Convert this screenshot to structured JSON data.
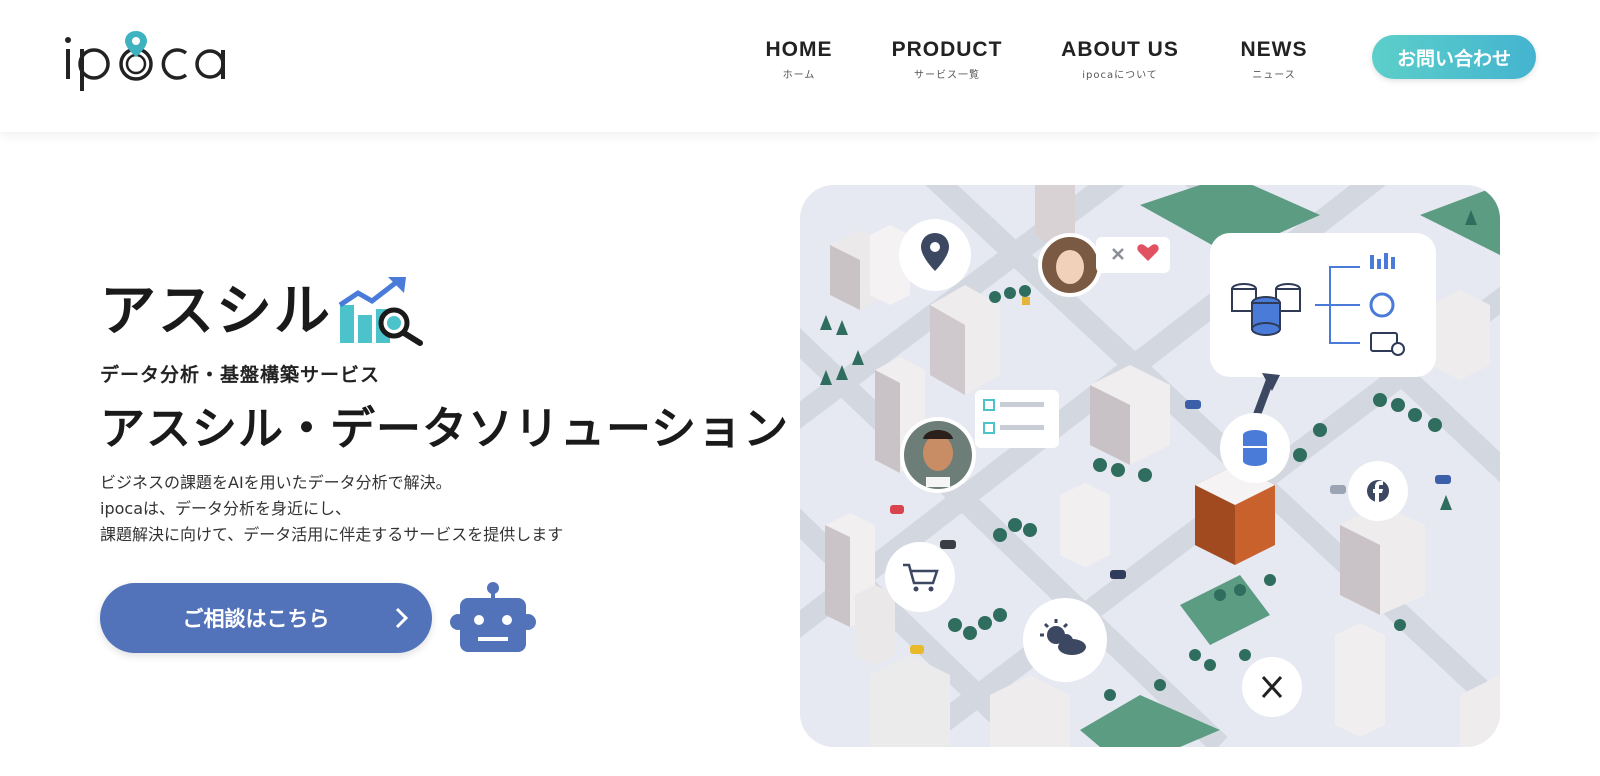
{
  "header": {
    "logo_text": "ipoca",
    "nav": [
      {
        "label": "HOME",
        "sub": "ホーム"
      },
      {
        "label": "PRODUCT",
        "sub": "サービス一覧"
      },
      {
        "label": "ABOUT US",
        "sub": "ipocaについて"
      },
      {
        "label": "NEWS",
        "sub": "ニュース"
      }
    ],
    "contact_label": "お問い合わせ"
  },
  "hero": {
    "brand_name": "アスシル",
    "subtitle": "データ分析・基盤構築サービス",
    "title": "アスシル・データソリューション",
    "description": [
      "ビジネスの課題をAIを用いたデータ分析で解決。",
      "ipocaは、データ分析を身近にし、",
      "課題解決に向けて、データ活用に伴走するサービスを提供します"
    ],
    "cta_label": "ご相談はこちら"
  },
  "colors": {
    "accent_teal": "#4cc3cb",
    "cta_blue": "#5273b9",
    "tree_green": "#2f6e5f",
    "building_orange": "#c8612c"
  },
  "icons": [
    "location-pin-icon",
    "heart-icon",
    "close-icon",
    "database-icon",
    "chart-icon",
    "facebook-icon",
    "shopping-cart-icon",
    "weather-icon",
    "x-social-icon",
    "robot-icon",
    "magnifier-icon"
  ]
}
